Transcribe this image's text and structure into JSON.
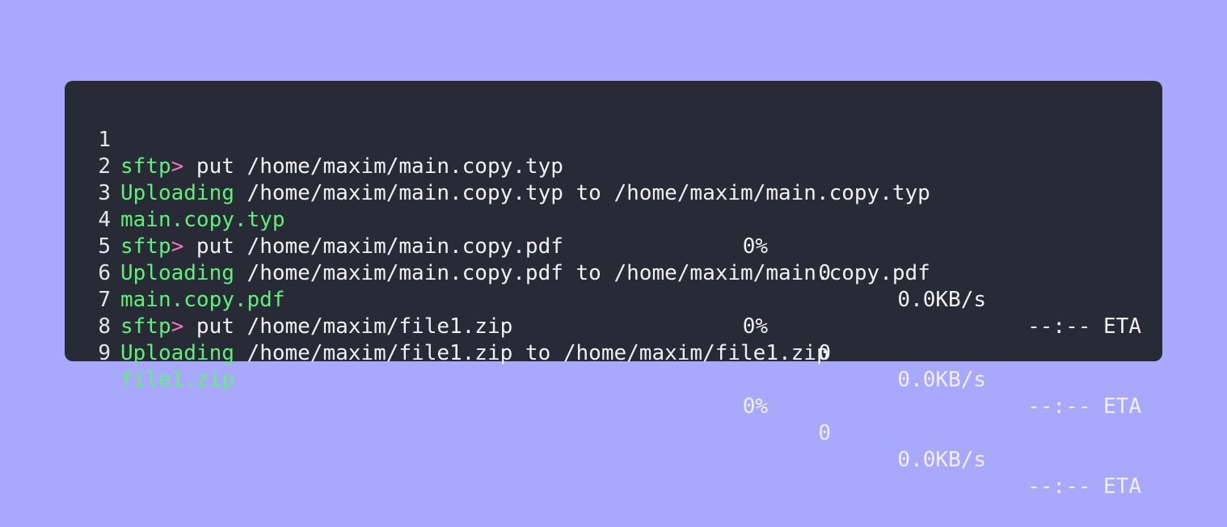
{
  "code": {
    "lines": [
      {
        "number": "1",
        "prompt": "sftp",
        "prompt_symbol": ">",
        "command": " put /home/maxim/main.copy.typ"
      },
      {
        "number": "2",
        "keyword": "Uploading",
        "text": " /home/maxim/main.copy.typ to /home/maxim/main.copy.typ"
      },
      {
        "number": "3",
        "file": "main.copy.typ",
        "percent": "0%",
        "bytes": "0",
        "rate": "0.0KB/s",
        "eta": "--:-- ETA"
      },
      {
        "number": "4",
        "prompt": "sftp",
        "prompt_symbol": ">",
        "command": " put /home/maxim/main.copy.pdf"
      },
      {
        "number": "5",
        "keyword": "Uploading",
        "text": " /home/maxim/main.copy.pdf to /home/maxim/main.copy.pdf"
      },
      {
        "number": "6",
        "file": "main.copy.pdf",
        "percent": "0%",
        "bytes": "0",
        "rate": "0.0KB/s",
        "eta": "--:-- ETA"
      },
      {
        "number": "7",
        "prompt": "sftp",
        "prompt_symbol": ">",
        "command": " put /home/maxim/file1.zip"
      },
      {
        "number": "8",
        "keyword": "Uploading",
        "text": " /home/maxim/file1.zip to /home/maxim/file1.zip"
      },
      {
        "number": "9",
        "file": "file1.zip",
        "percent": "0%",
        "bytes": "0",
        "rate": "0.0KB/s",
        "eta": "--:-- ETA"
      }
    ]
  },
  "colors": {
    "background": "#a8a8fc",
    "window": "#282b36",
    "text": "#f0f0f2",
    "green": "#5ff07a",
    "pink": "#f472c2"
  }
}
